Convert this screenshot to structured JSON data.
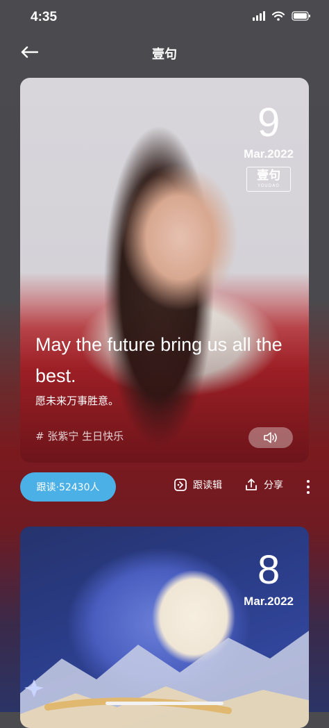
{
  "status_bar": {
    "time": "4:35"
  },
  "nav": {
    "title": "壹句"
  },
  "cards": [
    {
      "day": "9",
      "month": "Mar.2022",
      "logo_main": "壹句",
      "logo_sub": "YOUDAO",
      "quote_en": "May the future bring us all the best.",
      "quote_zh": "愿未来万事胜意。",
      "tags": "# 张紫宁 生日快乐"
    },
    {
      "day": "8",
      "month": "Mar.2022"
    }
  ],
  "actions": {
    "follow_label": "跟读·52430人",
    "edit_label": "跟读辑",
    "share_label": "分享"
  },
  "icons": [
    "back-arrow-icon",
    "signal-icon",
    "wifi-icon",
    "battery-icon",
    "speaker-icon",
    "edit-icon",
    "share-icon",
    "more-icon"
  ],
  "colors": {
    "follow_button": "#4bb0e6"
  }
}
